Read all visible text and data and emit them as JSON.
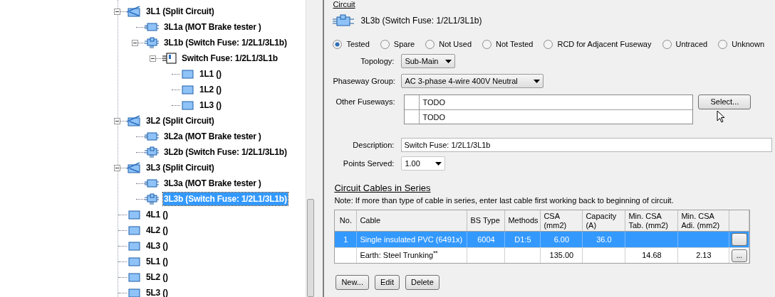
{
  "tree": {
    "items": [
      {
        "label": "3L1 (Split Circuit)",
        "kind": "split",
        "expanded": true,
        "selected": false,
        "children": [
          {
            "label": "3L1a (MOT Brake tester )",
            "kind": "load",
            "selected": false
          },
          {
            "label": "3L1b (Switch Fuse: 1/2L1/3L1b)",
            "kind": "switchfuse",
            "expanded": true,
            "selected": false,
            "children": [
              {
                "label": "Switch Fuse: 1/2L1/3L1b",
                "kind": "fusebox",
                "expanded": true,
                "selected": false,
                "children": [
                  {
                    "label": "1L1 ()",
                    "kind": "plain",
                    "selected": false
                  },
                  {
                    "label": "1L2 ()",
                    "kind": "plain",
                    "selected": false
                  },
                  {
                    "label": "1L3 ()",
                    "kind": "plain",
                    "selected": false
                  }
                ]
              }
            ]
          }
        ]
      },
      {
        "label": "3L2 (Split Circuit)",
        "kind": "split",
        "expanded": true,
        "selected": false,
        "children": [
          {
            "label": "3L2a (MOT Brake tester )",
            "kind": "load",
            "selected": false
          },
          {
            "label": "3L2b (Switch Fuse: 1/2L1/3L1b)",
            "kind": "switchfuse",
            "selected": false
          }
        ]
      },
      {
        "label": "3L3 (Split Circuit)",
        "kind": "split",
        "expanded": true,
        "selected": false,
        "children": [
          {
            "label": "3L3a (MOT Brake tester )",
            "kind": "load",
            "selected": false
          },
          {
            "label": "3L3b (Switch Fuse: 1/2L1/3L1b)",
            "kind": "switchfuse",
            "selected": true
          }
        ]
      },
      {
        "label": "4L1 ()",
        "kind": "plain",
        "selected": false
      },
      {
        "label": "4L2 ()",
        "kind": "plain",
        "selected": false
      },
      {
        "label": "4L3 ()",
        "kind": "plain",
        "selected": false
      },
      {
        "label": "5L1 ()",
        "kind": "plain",
        "selected": false
      },
      {
        "label": "5L2 ()",
        "kind": "plain",
        "selected": false
      },
      {
        "label": "5L3 ()",
        "kind": "plain",
        "selected": false
      }
    ]
  },
  "circuit": {
    "heading": "Circuit",
    "name": "3L3b (Switch Fuse: 1/2L1/3L1b)",
    "status_options": [
      {
        "label": "Tested",
        "selected": true
      },
      {
        "label": "Spare",
        "selected": false
      },
      {
        "label": "Not Used",
        "selected": false
      },
      {
        "label": "Not Tested",
        "selected": false
      },
      {
        "label": "RCD for Adjacent Fuseway",
        "selected": false
      },
      {
        "label": "Untraced",
        "selected": false
      },
      {
        "label": "Unknown",
        "selected": false
      }
    ],
    "topology": {
      "label": "Topology:",
      "value": "Sub-Main"
    },
    "phaseway_group": {
      "label": "Phaseway Group:",
      "value": "AC 3-phase 4-wire 400V Neutral"
    },
    "other_fuseways": {
      "label": "Other Fuseways:",
      "rows": [
        "TODO",
        "TODO"
      ],
      "button": "Select..."
    },
    "description": {
      "label": "Description:",
      "value": "Switch Fuse: 1/2L1/3L1b"
    },
    "points_served": {
      "label": "Points Served:",
      "value": "1.00"
    }
  },
  "cables": {
    "heading": "Circuit Cables in Series",
    "note": "Note: If more than type of cable in series, enter last cable first working back to beginning of circuit.",
    "columns": [
      "No.",
      "Cable",
      "BS Type",
      "Methods",
      "CSA (mm2)",
      "Capacity (A)",
      "Min. CSA Tab. (mm2)",
      "Min. CSA Adi. (mm2)"
    ],
    "rows": [
      {
        "cells": [
          "1",
          "Single insulated PVC (6491x)",
          "6004",
          "D1:5",
          "6.00",
          "36.0",
          "",
          ""
        ],
        "button": "",
        "selected": true
      },
      {
        "cells": [
          "",
          "Earth: Steel Trunking$^{**}$",
          "",
          "",
          "135.00",
          "",
          "14.68",
          "2.13"
        ],
        "button": "...",
        "selected": false
      }
    ],
    "buttons": [
      "New...",
      "Edit",
      "Delete"
    ]
  }
}
